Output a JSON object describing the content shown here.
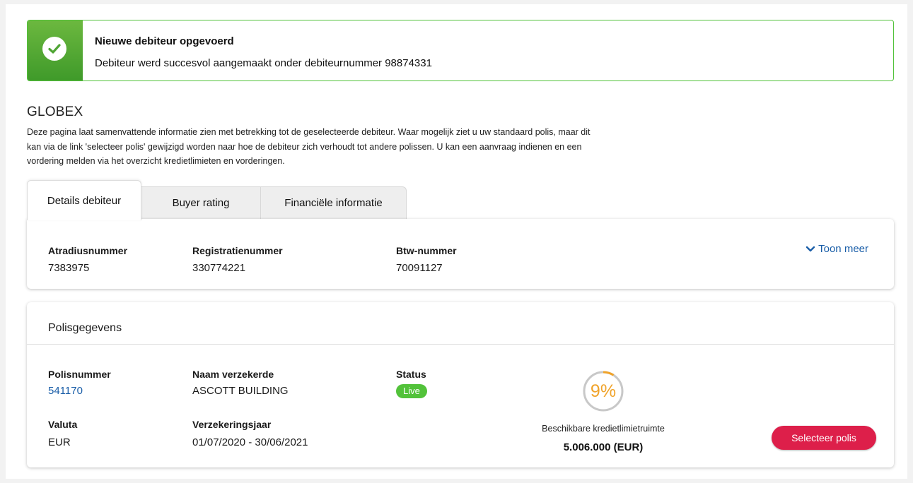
{
  "banner": {
    "title": "Nieuwe debiteur opgevoerd",
    "message": "Debiteur werd succesvol aangemaakt onder debiteurnummer 98874331",
    "icon": "check-icon",
    "color": "#52c23a"
  },
  "company": {
    "name": "GLOBEX",
    "description": "Deze pagina laat samenvattende informatie zien met betrekking tot de geselecteerde debiteur. Waar mogelijk ziet u uw standaard polis, maar dit kan via de link 'selecteer polis' gewijzigd worden naar hoe de debiteur zich verhoudt tot andere polissen. U kan een aanvraag indienen en een vordering melden via het overzicht kredietlimieten en vorderingen."
  },
  "tabs": [
    {
      "label": "Details debiteur",
      "active": true
    },
    {
      "label": "Buyer rating",
      "active": false
    },
    {
      "label": "Financiële informatie",
      "active": false
    }
  ],
  "details": {
    "fields": [
      {
        "label": "Atradiusnummer",
        "value": "7383975"
      },
      {
        "label": "Registratienummer",
        "value": "330774221"
      },
      {
        "label": "Btw-nummer",
        "value": "70091127"
      }
    ],
    "toggle_label": "Toon meer",
    "toggle_icon": "chevron-down-icon"
  },
  "policy": {
    "title": "Polisgegevens",
    "polisnummer_label": "Polisnummer",
    "polisnummer_value": "541170",
    "naam_label": "Naam verzekerde",
    "naam_value": "ASCOTT BUILDING",
    "status_label": "Status",
    "status_value": "Live",
    "valuta_label": "Valuta",
    "valuta_value": "EUR",
    "jaar_label": "Verzekeringsjaar",
    "jaar_value": "01/07/2020 - 30/06/2021",
    "gauge_percent_text": "9%",
    "gauge_fraction": 0.09,
    "gauge_color": "#f0a32a",
    "credit_label": "Beschikbare kredietlimietruimte",
    "credit_value": "5.006.000 (EUR)",
    "select_button": "Selecteer polis",
    "select_color": "#dd1f4a"
  }
}
